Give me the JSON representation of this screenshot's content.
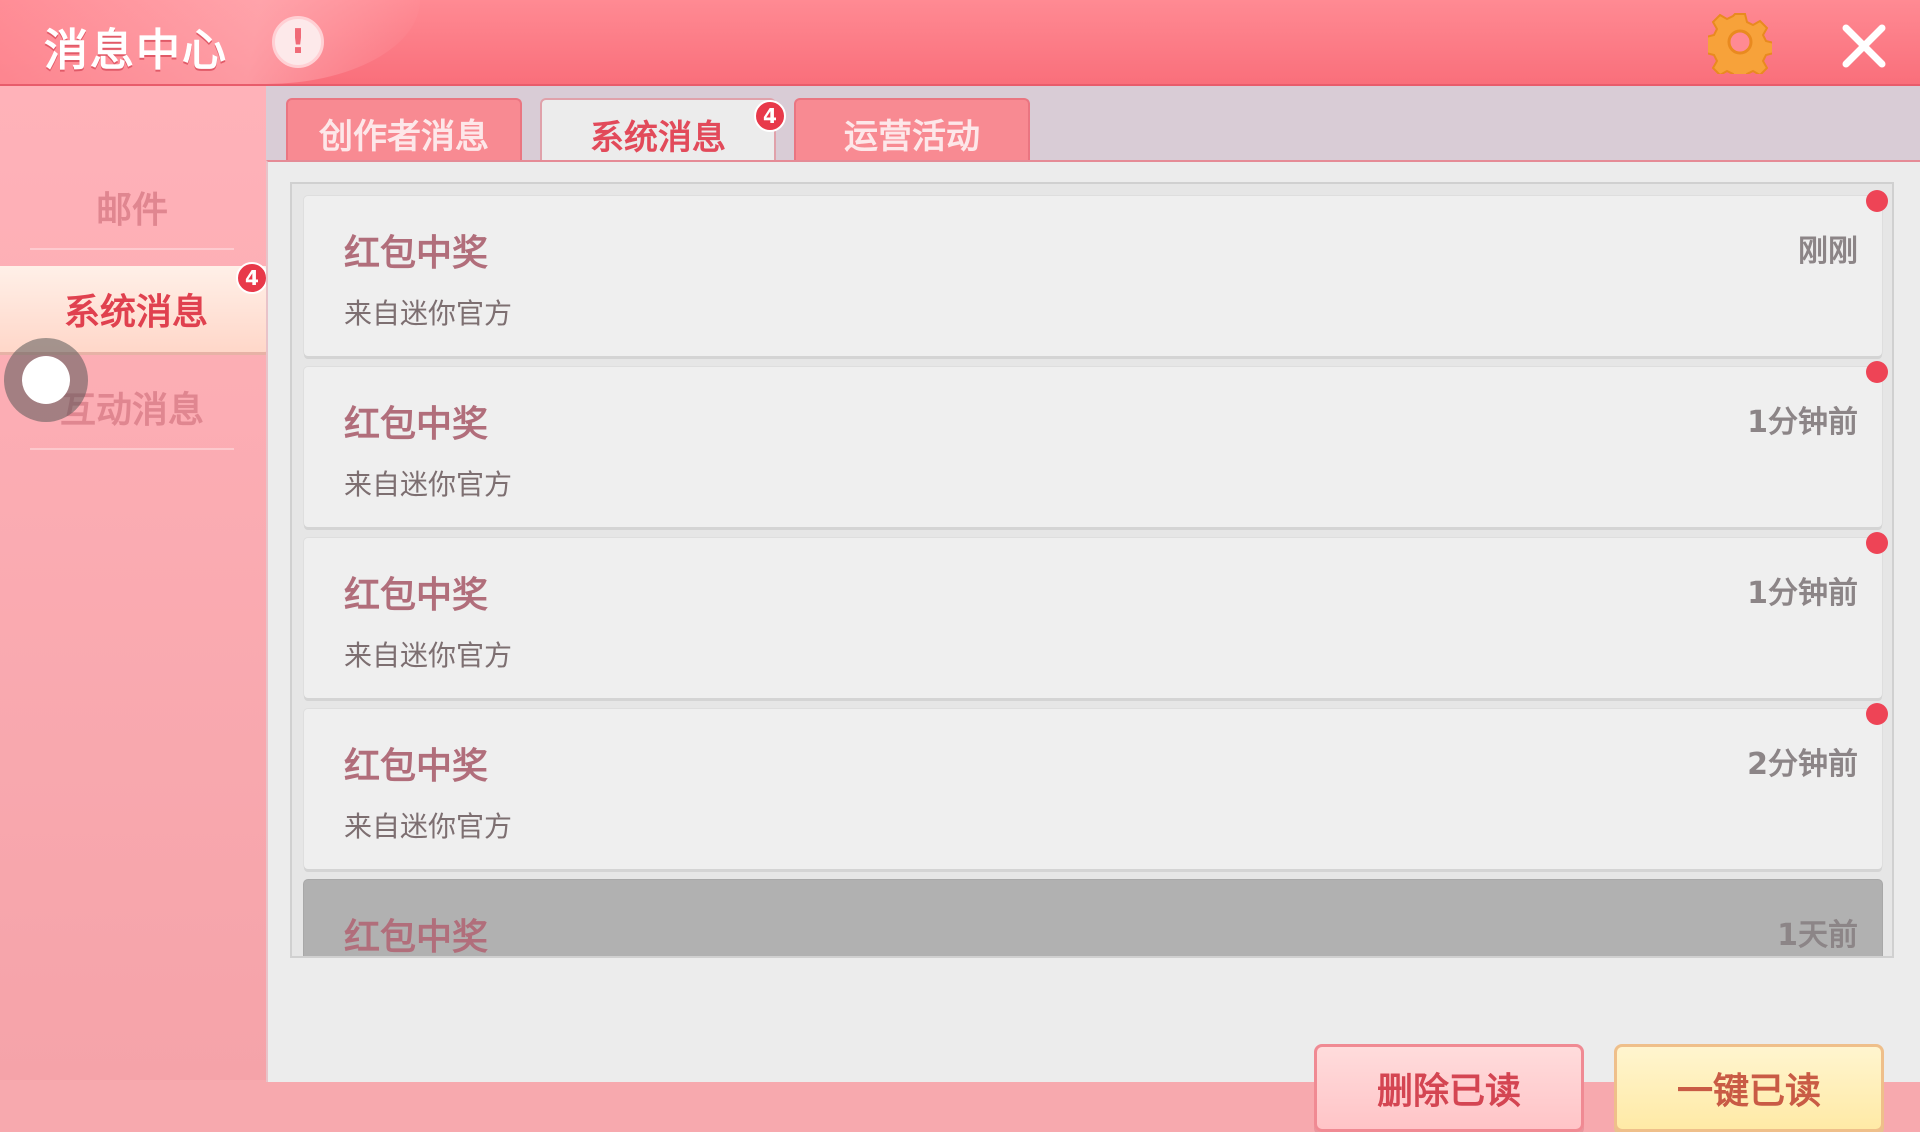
{
  "header": {
    "title": "消息中心",
    "alert_icon_glyph": "!"
  },
  "sidebar": {
    "items": [
      {
        "label": "邮件",
        "active": false
      },
      {
        "label": "系统消息",
        "active": true,
        "badge": "4"
      },
      {
        "label": "互动消息",
        "active": false
      }
    ]
  },
  "tabs": [
    {
      "label": "创作者消息",
      "active": false
    },
    {
      "label": "系统消息",
      "active": true,
      "badge": "4"
    },
    {
      "label": "运营活动",
      "active": false
    }
  ],
  "messages": [
    {
      "title": "红包中奖",
      "source": "来自迷你官方",
      "time": "刚刚",
      "unread": true
    },
    {
      "title": "红包中奖",
      "source": "来自迷你官方",
      "time": "1分钟前",
      "unread": true
    },
    {
      "title": "红包中奖",
      "source": "来自迷你官方",
      "time": "1分钟前",
      "unread": true
    },
    {
      "title": "红包中奖",
      "source": "来自迷你官方",
      "time": "2分钟前",
      "unread": true
    },
    {
      "title": "红包中奖",
      "source": "",
      "time": "1天前",
      "unread": false
    }
  ],
  "actions": {
    "delete_read_label": "删除已读",
    "mark_all_read_label": "一键已读"
  },
  "colors": {
    "header": "#f96f7b",
    "accent_red": "#e8394a",
    "active_tab_text": "#e24a5a",
    "message_title": "#b16e7b"
  }
}
